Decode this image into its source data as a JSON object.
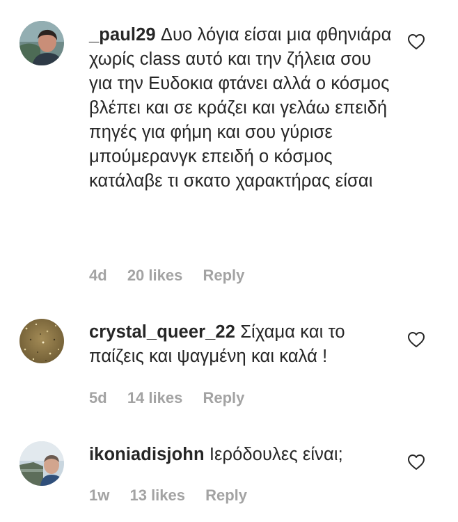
{
  "comments": [
    {
      "username": "_paul29",
      "text": "Δυο λόγια είσαι μια φθηνιάρα χωρίς class αυτό και την ζήλεια σου για την Ευδοκια φτάνει αλλά ο κόσμος βλέπει και σε κράζει και γελάω επειδή πηγές για φήμη και σου γύρισε μπούμερανγκ επειδή ο κόσμος κατάλαβε τι σκατο χαρακτήρας είσαι",
      "age": "4d",
      "likes": "20 likes",
      "reply": "Reply",
      "avatar_icon": "user-avatar-photo",
      "like_icon": "heart-outline-icon"
    },
    {
      "username": "crystal_queer_22",
      "text": "Σίχαμα και το παίζεις και ψαγμένη και καλά !",
      "age": "5d",
      "likes": "14 likes",
      "reply": "Reply",
      "avatar_icon": "glitter-avatar",
      "like_icon": "heart-outline-icon"
    },
    {
      "username": "ikoniadisjohn",
      "text": "Ιερόδουλες είναι;",
      "age": "1w",
      "likes": "13 likes",
      "reply": "Reply",
      "avatar_icon": "user-avatar-photo",
      "like_icon": "heart-outline-icon"
    }
  ],
  "colors": {
    "text": "#262626",
    "meta": "#a3a3a3",
    "icon": "#262626"
  }
}
